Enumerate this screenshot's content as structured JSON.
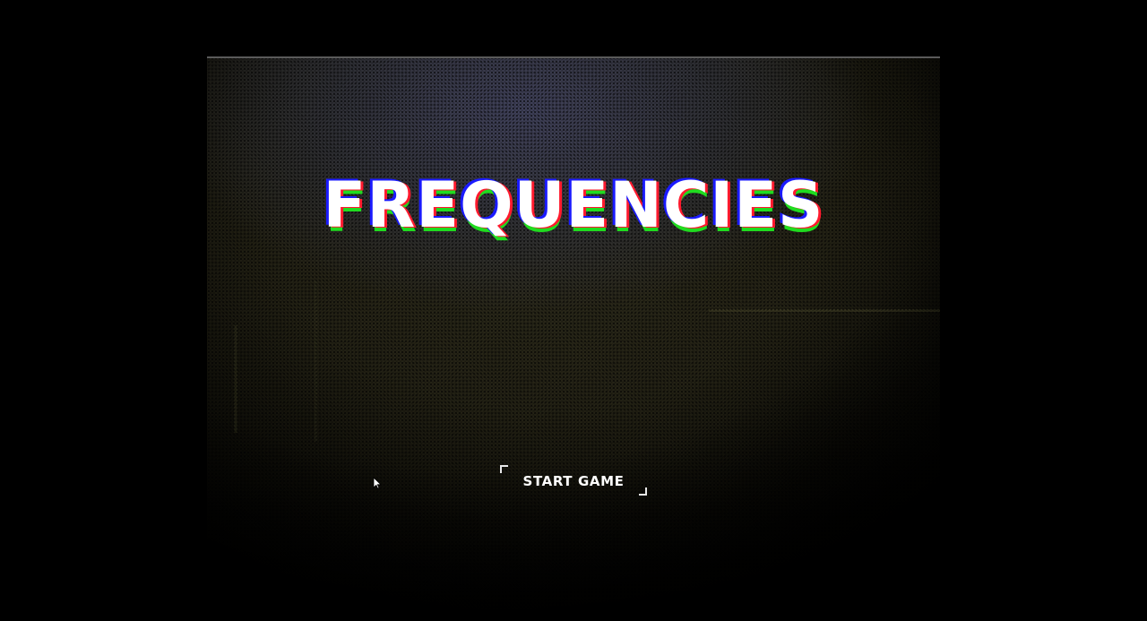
{
  "game": {
    "title": "FREQUENCIES",
    "start_button_label": "START GAME"
  },
  "colors": {
    "background": "#000000",
    "title_text": "#ffffff",
    "glitch_blue": "#1a1aff",
    "glitch_red": "#ff1a2e",
    "glitch_green": "#1fdc1f",
    "button_corners": "#e8e8e8"
  },
  "icons": {
    "cursor": "mouse-pointer-icon"
  }
}
